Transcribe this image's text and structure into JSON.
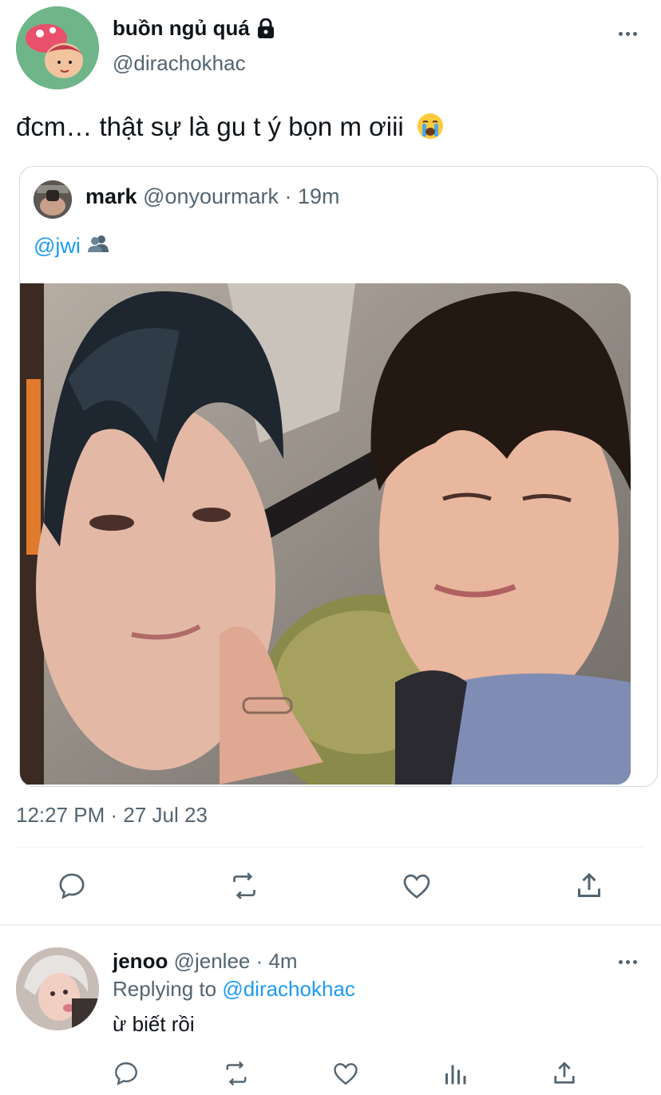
{
  "main_tweet": {
    "display_name": "buồn ngủ quá",
    "handle": "@dirachokhac",
    "text": "đcm… thật sự là gu t ý bọn m ơiii",
    "emoji": "loudly-crying-face",
    "timestamp": "12:27 PM · 27 Jul 23"
  },
  "quote": {
    "name": "mark",
    "handle_time": "@onyourmark · 19m",
    "text": "@jwi",
    "emoji": "busts-in-silhouette"
  },
  "actions": [
    "reply-icon",
    "retweet-icon",
    "like-icon",
    "share-icon"
  ],
  "reply": {
    "name": "jenoo",
    "handle_time": "@jenlee · 4m",
    "replying_prefix": "Replying to",
    "replying_to": "@dirachokhac",
    "text": "ừ biết rồi",
    "actions": [
      "reply-icon",
      "retweet-icon",
      "like-icon",
      "analytics-icon",
      "share-icon"
    ]
  },
  "colors": {
    "text": "#0f1419",
    "secondary": "#536471",
    "link": "#1d9bf0",
    "border": "#cfd9de"
  }
}
